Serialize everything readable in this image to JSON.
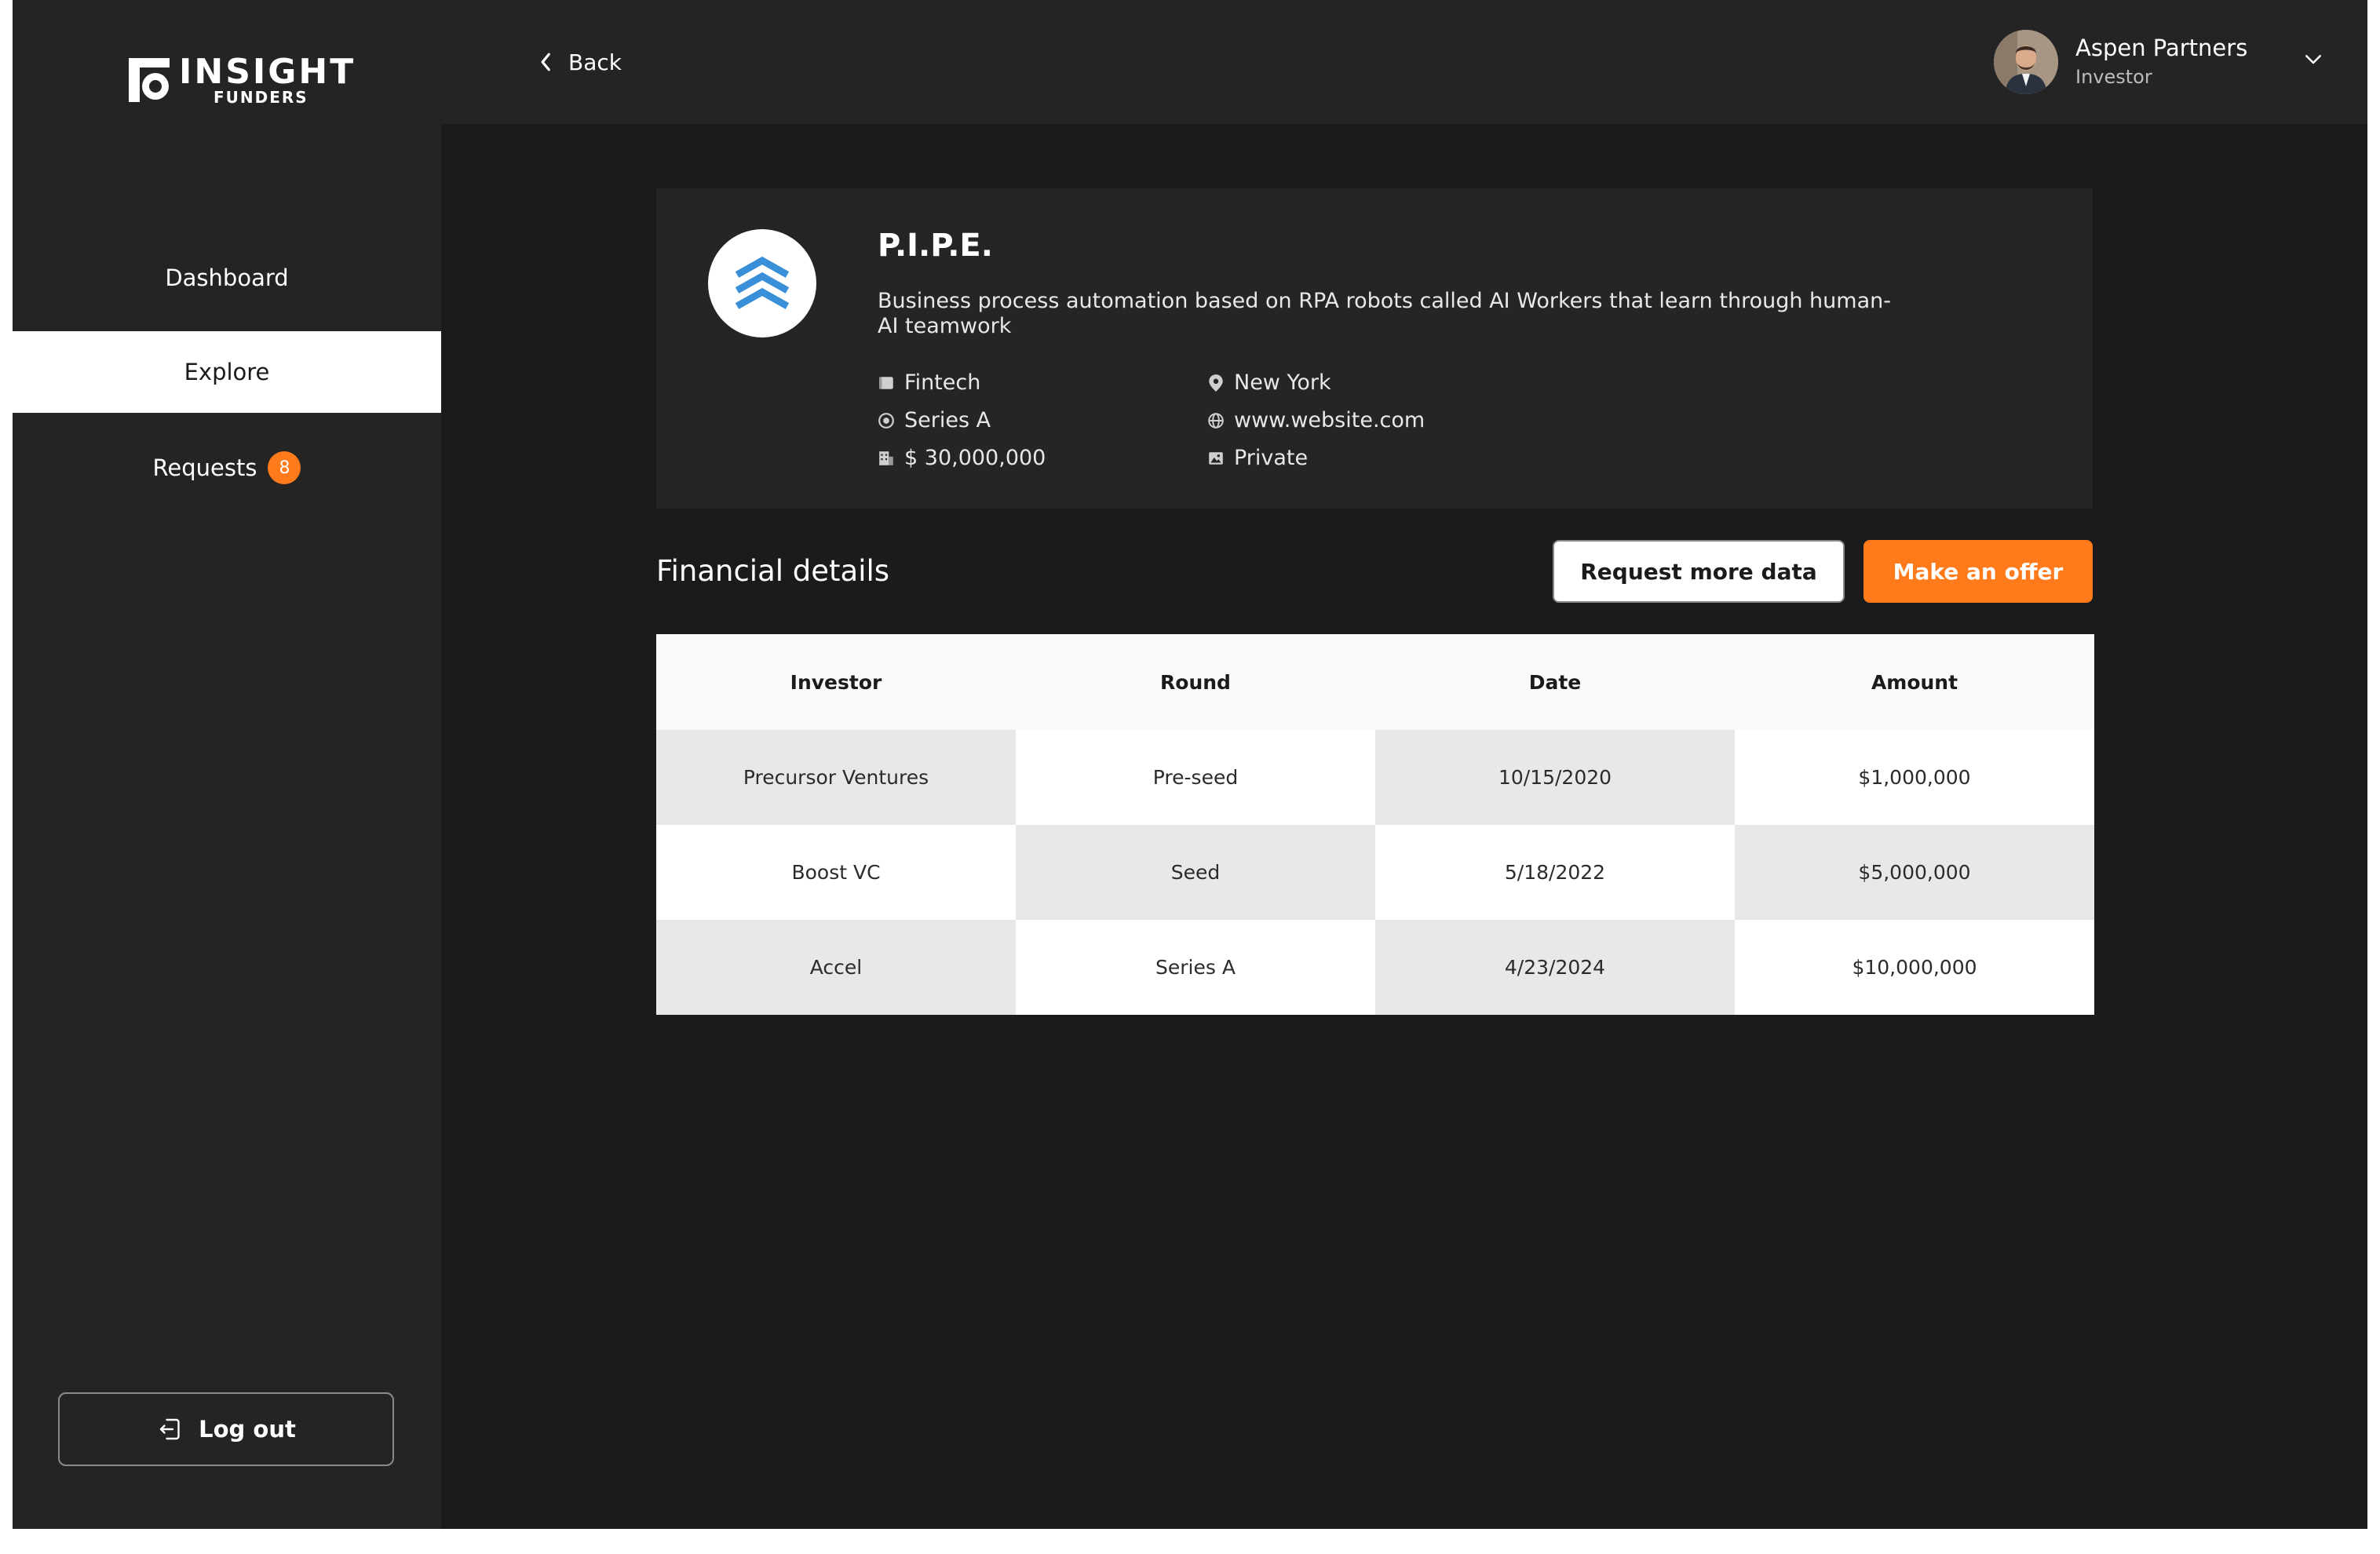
{
  "brand": {
    "logo_line1": "INSIGHT",
    "logo_line2": "FUNDERS"
  },
  "sidebar": {
    "items": [
      {
        "label": "Dashboard"
      },
      {
        "label": "Explore",
        "active": true
      },
      {
        "label": "Requests",
        "badge": "8"
      }
    ],
    "logout_label": "Log out"
  },
  "topbar": {
    "back_label": "Back",
    "user": {
      "name": "Aspen Partners",
      "role": "Investor"
    }
  },
  "company": {
    "name": "P.I.P.E.",
    "description": "Business process automation based on RPA robots called AI Workers that learn through human-AI teamwork",
    "industry": "Fintech",
    "stage": "Series A",
    "valuation": "$ 30,000,000",
    "location": "New York",
    "website": "www.website.com",
    "ownership": "Private"
  },
  "financial": {
    "title": "Financial details",
    "request_label": "Request more data",
    "offer_label": "Make an offer",
    "columns": [
      "Investor",
      "Round",
      "Date",
      "Amount"
    ],
    "rows": [
      [
        "Precursor Ventures",
        "Pre-seed",
        "10/15/2020",
        "$1,000,000"
      ],
      [
        "Boost VC",
        "Seed",
        "5/18/2022",
        "$5,000,000"
      ],
      [
        "Accel",
        "Series A",
        "4/23/2024",
        "$10,000,000"
      ]
    ]
  },
  "colors": {
    "accent": "#ff7a1a",
    "app_bg": "#1b1b1b",
    "panel_bg": "#242424",
    "card_bg": "#252525",
    "company_logo_blue": "#3a8fd9"
  }
}
